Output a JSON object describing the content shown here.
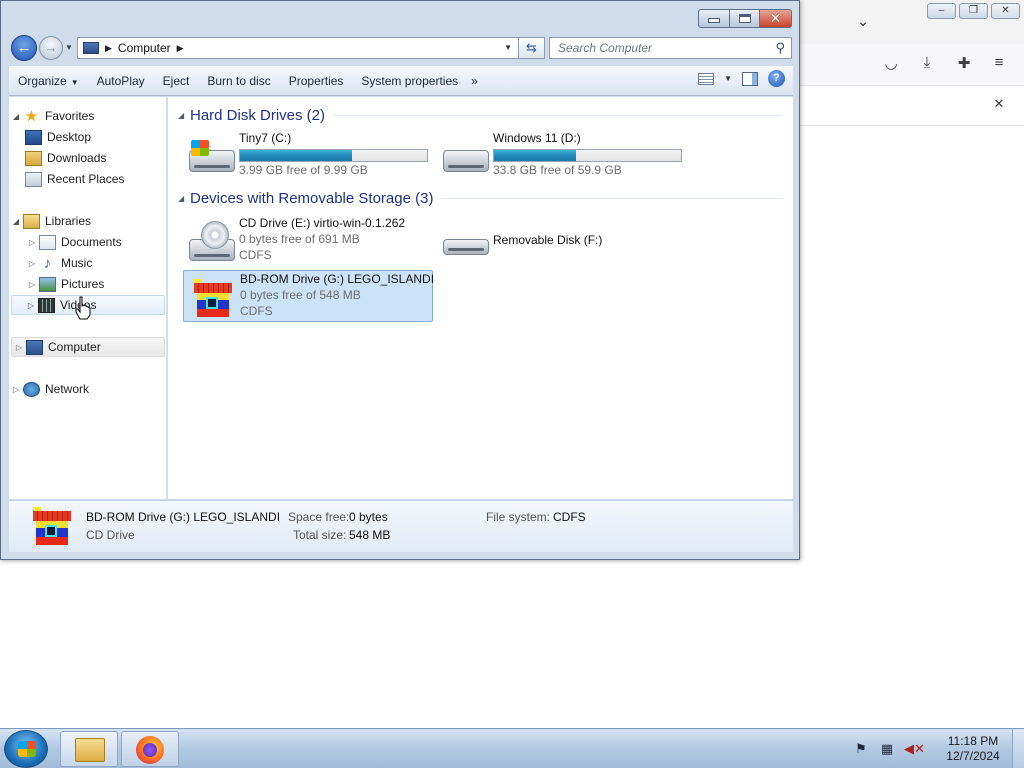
{
  "explorer": {
    "address": {
      "location": "Computer"
    },
    "search": {
      "placeholder": "Search Computer"
    },
    "commands": {
      "organize": "Organize",
      "autoplay": "AutoPlay",
      "eject": "Eject",
      "burn": "Burn to disc",
      "properties": "Properties",
      "system_properties": "System properties",
      "more": "»"
    },
    "nav": {
      "favorites": "Favorites",
      "desktop": "Desktop",
      "downloads": "Downloads",
      "recent_places": "Recent Places",
      "libraries": "Libraries",
      "documents": "Documents",
      "music": "Music",
      "pictures": "Pictures",
      "videos": "Videos",
      "computer": "Computer",
      "network": "Network"
    },
    "groups": {
      "hdd": "Hard Disk Drives (2)",
      "removable": "Devices with Removable Storage (3)"
    },
    "drives": {
      "c": {
        "name": "Tiny7 (C:)",
        "free": "3.99 GB free of 9.99 GB",
        "used_fraction": 0.6
      },
      "d": {
        "name": "Windows 11 (D:)",
        "free": "33.8 GB free of 59.9 GB",
        "used_fraction": 0.44
      },
      "e": {
        "name": "CD Drive (E:) virtio-win-0.1.262",
        "free": "0 bytes free of 691 MB",
        "fs": "CDFS"
      },
      "f": {
        "name": "Removable Disk (F:)"
      },
      "g": {
        "name": "BD-ROM Drive (G:) LEGO_ISLANDI",
        "free": "0 bytes free of 548 MB",
        "fs": "CDFS"
      }
    },
    "status": {
      "name": "BD-ROM Drive (G:) LEGO_ISLANDI",
      "type": "CD Drive",
      "space_free_label": "Space free:",
      "space_free": "0 bytes",
      "total_size_label": "Total size:",
      "total_size": "548 MB",
      "fs_label": "File system:",
      "fs": "CDFS"
    }
  },
  "taskbar": {
    "time": "11:18 PM",
    "date": "12/7/2024"
  },
  "icons": {
    "back": "back-arrow-icon",
    "forward": "forward-arrow-icon",
    "refresh": "refresh-icon",
    "search": "search-icon",
    "help": "help-icon"
  }
}
